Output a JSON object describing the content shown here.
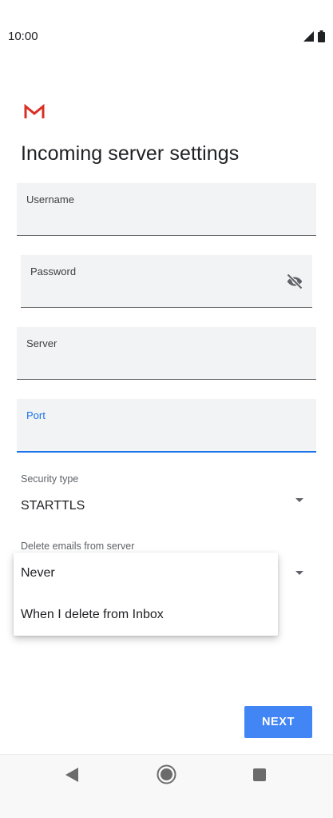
{
  "status_bar": {
    "time": "10:00",
    "icons": [
      "signal-icon",
      "battery-icon"
    ]
  },
  "app": {
    "logo": "gmail-logo"
  },
  "page": {
    "title": "Incoming server settings"
  },
  "fields": {
    "username": {
      "label": "Username",
      "value": ""
    },
    "password": {
      "label": "Password",
      "value": "",
      "toggle_icon": "visibility-off-icon"
    },
    "server": {
      "label": "Server",
      "value": ""
    },
    "port": {
      "label": "Port",
      "value": "",
      "focused": true
    }
  },
  "security_type": {
    "label": "Security type",
    "value": "STARTTLS"
  },
  "delete_emails": {
    "label": "Delete emails from server",
    "options": [
      "Never",
      "When I delete from Inbox"
    ]
  },
  "actions": {
    "next_label": "NEXT"
  },
  "nav": {
    "icons": [
      "back-icon",
      "home-icon",
      "recents-icon"
    ]
  },
  "colors": {
    "accent": "#4285f4",
    "focus": "#1a73e8",
    "field_bg": "#f1f3f4",
    "gmail_red": "#d93025"
  }
}
